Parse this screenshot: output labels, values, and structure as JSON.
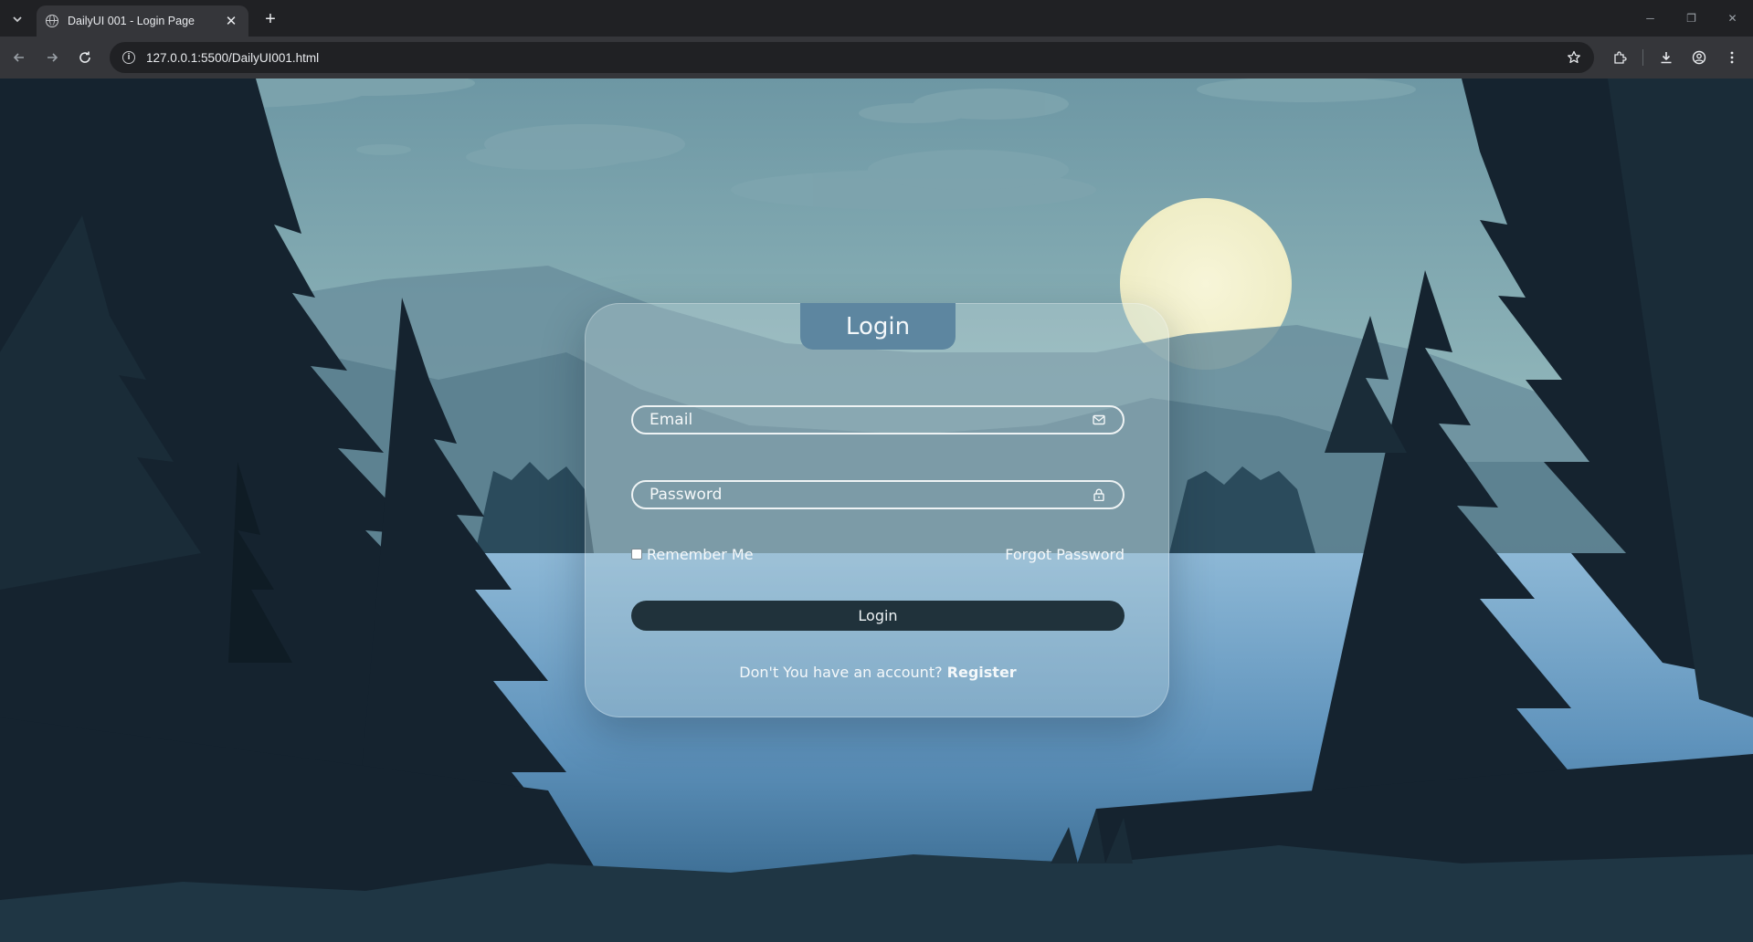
{
  "browser": {
    "tab_title": "DailyUI 001 - Login Page",
    "tab_close": "✕",
    "new_tab": "+",
    "url": "127.0.0.1:5500/DailyUI001.html",
    "window_controls": {
      "minimize": "─",
      "restore": "❐",
      "close": "✕"
    },
    "icons": [
      "tab-search-icon",
      "globe-icon",
      "back-arrow-icon",
      "forward-arrow-icon",
      "reload-icon",
      "site-info-icon",
      "bookmark-star-icon",
      "extensions-icon",
      "download-icon",
      "profile-icon",
      "menu-icon"
    ]
  },
  "login": {
    "title": "Login",
    "email_placeholder": "Email",
    "password_placeholder": "Password",
    "remember_label": "Remember Me",
    "remember_checked": false,
    "forgot_label": "Forgot Password",
    "submit_label": "Login",
    "register_prompt": "Don't You have an account?",
    "register_link": "Register",
    "icons": [
      "mail-icon",
      "lock-icon"
    ]
  },
  "colors": {
    "header_bg": "#5d86a0",
    "button_bg": "#20323b",
    "tree_silhouette": "#15232f",
    "moon": "#f3f1cf"
  }
}
